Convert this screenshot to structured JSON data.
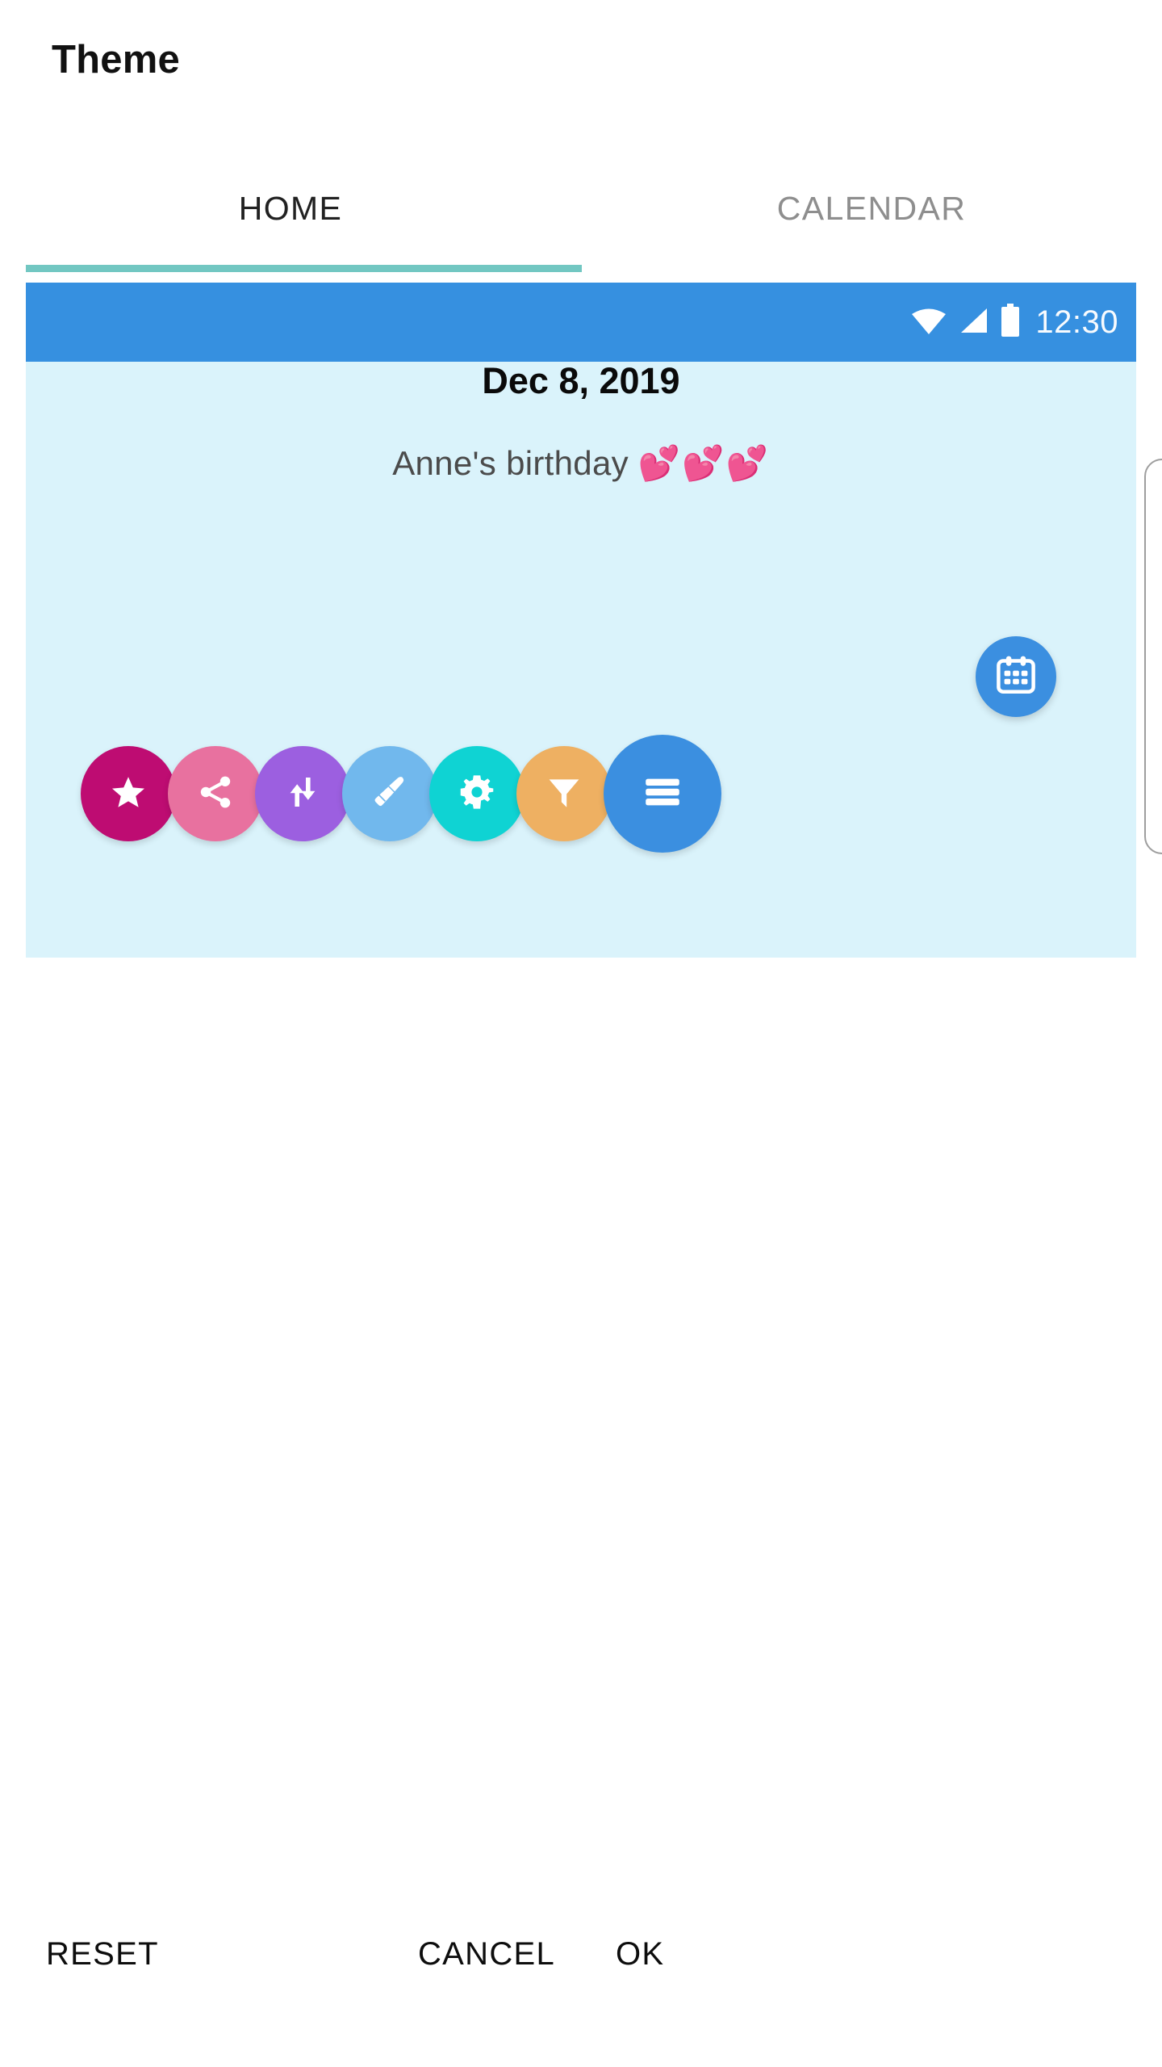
{
  "header": {
    "title": "Theme"
  },
  "tabs": [
    {
      "label": "HOME",
      "active": true,
      "name": "tab-home"
    },
    {
      "label": "CALENDAR",
      "active": false,
      "name": "tab-calendar"
    }
  ],
  "preview": {
    "status_bar": {
      "time": "12:30",
      "icons": [
        "wifi-icon",
        "signal-icon",
        "battery-icon"
      ],
      "background": "#3690e0"
    },
    "background": "#daf3fb",
    "date": "Dec 8, 2019",
    "event": "Anne's birthday",
    "event_emoji": "💕💕💕",
    "fab": {
      "icon": "calendar-icon",
      "color": "#3b8fe0"
    },
    "buttons": [
      {
        "icon": "star-icon",
        "color": "#be0c72",
        "name": "favorite-button"
      },
      {
        "icon": "share-icon",
        "color": "#e8719f",
        "name": "share-button"
      },
      {
        "icon": "sort-icon",
        "color": "#9c5fe0",
        "name": "sort-button"
      },
      {
        "icon": "brush-icon",
        "color": "#71b8ed",
        "name": "brush-button"
      },
      {
        "icon": "gear-icon",
        "color": "#0fd3d3",
        "name": "settings-button"
      },
      {
        "icon": "filter-icon",
        "color": "#eeb062",
        "name": "filter-button"
      },
      {
        "icon": "menu-icon",
        "color": "#3b8fe0",
        "name": "menu-button"
      }
    ]
  },
  "actions": [
    {
      "label": "RESET",
      "name": "reset-button"
    },
    {
      "label": "CANCEL",
      "name": "cancel-button"
    },
    {
      "label": "OK",
      "name": "ok-button"
    }
  ],
  "colors": {
    "tab_indicator": "#72c7c2",
    "tab_active_text": "#212121",
    "tab_inactive_text": "#8e8e8e"
  }
}
